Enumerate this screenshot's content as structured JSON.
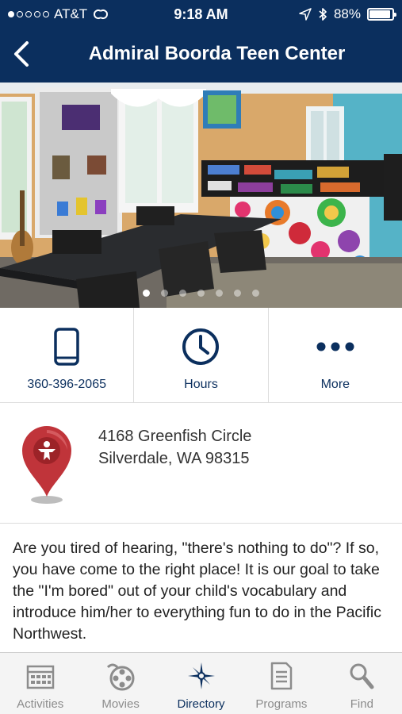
{
  "status_bar": {
    "carrier": "AT&T",
    "time": "9:18 AM",
    "battery": "88%",
    "battery_level": 0.88,
    "signal_bars_filled": 1,
    "signal_bars_total": 5
  },
  "nav": {
    "title": "Admiral Boorda Teen Center",
    "back_icon": "chevron-left-icon"
  },
  "gallery": {
    "page_count": 7,
    "current_page": 1
  },
  "actions": [
    {
      "label": "360-396-2065",
      "icon": "phone-icon"
    },
    {
      "label": "Hours",
      "icon": "clock-icon"
    },
    {
      "label": "More",
      "icon": "more-icon"
    }
  ],
  "address": {
    "line1": "4168 Greenfish Circle",
    "line2": "Silverdale, WA 98315",
    "icon": "map-pin-icon"
  },
  "description": "Are you tired of hearing, \"there's nothing to do\"? If so, you have come to the right place! It is our goal to take the \"I'm bored\" out of your child's vocabulary and introduce him/her to everything fun to do in the Pacific Northwest.",
  "tabs": [
    {
      "label": "Activities",
      "icon": "calendar-icon",
      "active": false
    },
    {
      "label": "Movies",
      "icon": "film-reel-icon",
      "active": false
    },
    {
      "label": "Directory",
      "icon": "compass-star-icon",
      "active": true
    },
    {
      "label": "Programs",
      "icon": "document-icon",
      "active": false
    },
    {
      "label": "Find",
      "icon": "magnifier-icon",
      "active": false
    }
  ],
  "colors": {
    "brand_navy": "#0b2f5e",
    "pin_red": "#c0343a",
    "tab_inactive": "#8c8c8c"
  }
}
